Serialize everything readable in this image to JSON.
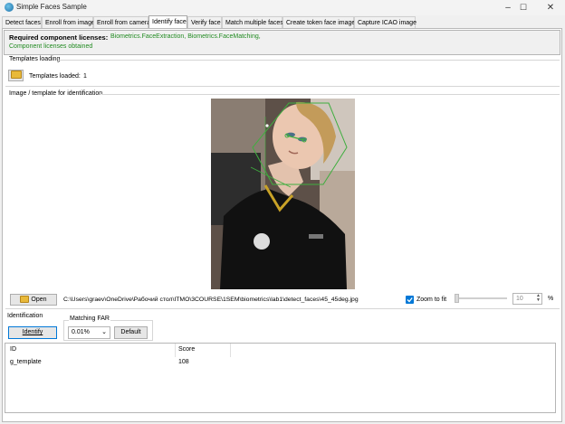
{
  "window": {
    "title": "Simple Faces Sample",
    "controls": [
      "–",
      "☐",
      "✕"
    ]
  },
  "tabs": [
    {
      "label": "Detect faces",
      "active": false
    },
    {
      "label": "Enroll from image",
      "active": false
    },
    {
      "label": "Enroll from camera",
      "active": false
    },
    {
      "label": "Identify face",
      "active": true
    },
    {
      "label": "Verify face",
      "active": false
    },
    {
      "label": "Match multiple faces",
      "active": false
    },
    {
      "label": "Create token face image",
      "active": false
    },
    {
      "label": "Capture ICAO image",
      "active": false
    }
  ],
  "licenses": {
    "label": "Required component licenses:",
    "components": "Biometrics.FaceExtraction, Biometrics.FaceMatching,",
    "status": "Component licenses obtained"
  },
  "templates": {
    "group_title": "Templates loading",
    "loaded_label": "Templates loaded:",
    "loaded_count": "1"
  },
  "image_group": {
    "title": "Image / template for identification",
    "open_label": "Open",
    "file_path": "C:\\Users\\graev\\OneDrive\\Рабочий стол\\ITMO\\3COURSE\\1SEM\\biometrics\\lab1\\detect_faces\\45_45deg.jpg",
    "zoom_to_fit_label": "Zoom to fit",
    "zoom_to_fit_checked": true,
    "zoom_value": "10",
    "zoom_unit": "%"
  },
  "identification": {
    "group_title": "Identification",
    "identify_label": "Identify",
    "far_label": "Matching FAR",
    "far_value": "0.01%",
    "default_label": "Default"
  },
  "results": {
    "columns": [
      "ID",
      "Score"
    ],
    "rows": [
      {
        "id": "g_template",
        "score": "108"
      }
    ]
  },
  "colors": {
    "accent": "#0078d7",
    "license_green": "#208a20",
    "face_box": "#3fae3f"
  }
}
